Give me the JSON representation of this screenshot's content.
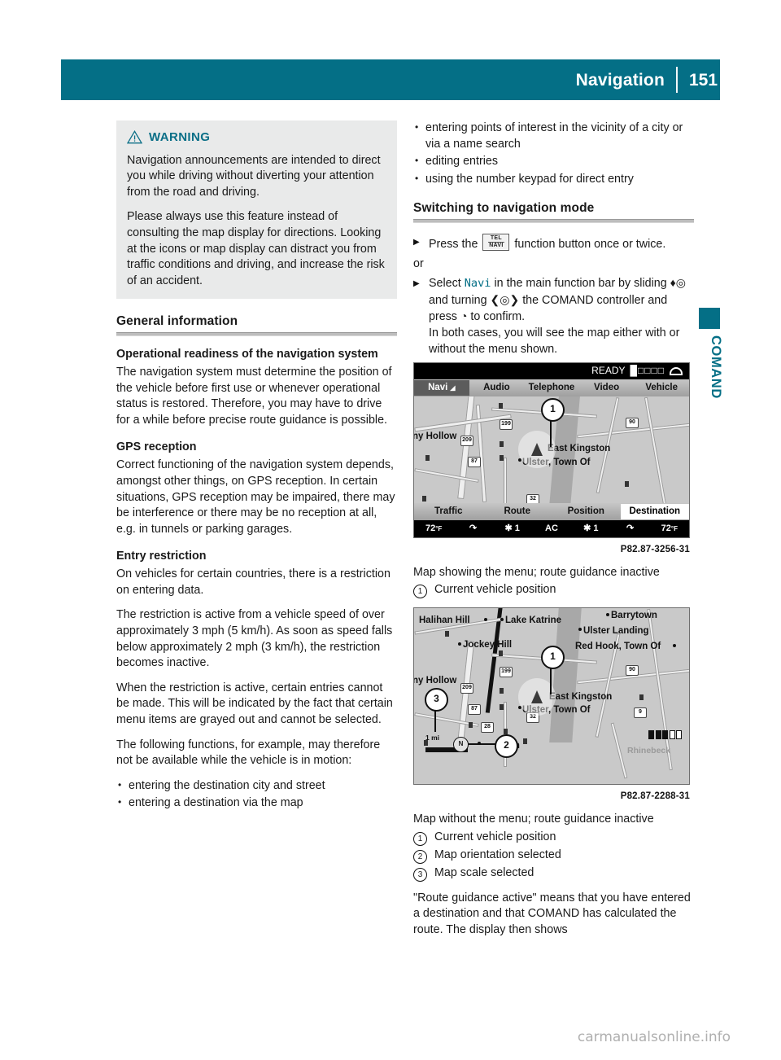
{
  "header": {
    "title": "Navigation",
    "page_number": "151",
    "accent_color": "#046f86"
  },
  "side_tab": {
    "label": "COMAND"
  },
  "footer": {
    "watermark": "carmanualsonline.info"
  },
  "warning": {
    "icon": "warning-triangle-icon",
    "label": "WARNING",
    "paragraphs": [
      "Navigation announcements are intended to direct you while driving without diverting your attention from the road and driving.",
      "Please always use this feature instead of consulting the map display for directions. Looking at the icons or map display can distract you from traffic conditions and driving, and increase the risk of an accident."
    ]
  },
  "left_column": {
    "section_title": "General information",
    "sub1_title": "Operational readiness of the navigation system",
    "sub1_text": "The navigation system must determine the position of the vehicle before first use or whenever operational status is restored. Therefore, you may have to drive for a while before precise route guidance is possible.",
    "sub2_title": "GPS reception",
    "sub2_text": "Correct functioning of the navigation system depends, amongst other things, on GPS reception. In certain situations, GPS reception may be impaired, there may be interference or there may be no reception at all, e.g. in tunnels or parking garages.",
    "sub3_title": "Entry restriction",
    "sub3_p1": "On vehicles for certain countries, there is a restriction on entering data.",
    "sub3_p2": "The restriction is active from a vehicle speed of over approximately 3 mph (5 km/h). As soon as speed falls below approximately 2 mph (3 km/h), the restriction becomes inactive.",
    "sub3_p3": "When the restriction is active, certain entries cannot be made. This will be indicated by the fact that certain menu items are grayed out and cannot be selected.",
    "sub3_p4": "The following functions, for example, may therefore not be available while the vehicle is in motion:",
    "bullets": [
      "entering the destination city and street",
      "entering a destination via the map"
    ]
  },
  "right_column": {
    "bullets_continued": [
      "entering points of interest in the vicinity of a city or via a name search",
      "editing entries",
      "using the number keypad for direct entry"
    ],
    "section_title": "Switching to navigation mode",
    "step1_before": "Press the",
    "step1_key_top": "TEL",
    "step1_key_bottom": "NAVI",
    "step1_after": "function button once or twice.",
    "or_text": "or",
    "step2_a": "Select",
    "step2_highlight": "Navi",
    "step2_b": "in the main function bar by sliding",
    "step2_slide_symbol": "♦◎",
    "step2_c": "and turning",
    "step2_turn_symbol": "❮◎❯",
    "step2_d": "the COMAND controller and press",
    "step2_press_symbol": "◔",
    "step2_e": "to confirm.",
    "step2_note": "In both cases, you will see the map either with or without the menu shown.",
    "closing_paragraph": "\"Route guidance active\" means that you have entered a destination and that COMAND has calculated the route. The display then shows"
  },
  "figure1": {
    "reference": "P82.87-3256-31",
    "caption": "Map showing the menu; route guidance inactive",
    "status_text": "READY",
    "status_blocks": "█□□□□",
    "phone_icon": "phone-handset-icon",
    "menu_items": [
      "Navi",
      "Audio",
      "Telephone",
      "Video",
      "Vehicle"
    ],
    "menu_selected": "Navi",
    "bottom_items": [
      "Traffic",
      "Route",
      "Position",
      "Destination"
    ],
    "bottom_selected": "Destination",
    "climate": {
      "left_temp": "72",
      "left_unit": "F",
      "right_temp": "72",
      "right_unit": "F",
      "left_fan": "1",
      "right_fan": "1",
      "ac_label": "AC"
    },
    "map_labels": [
      "ny Hollow",
      "East Kingston",
      "Ulster, Town Of"
    ],
    "route_shields": [
      "199",
      "209",
      "87",
      "90",
      "32"
    ],
    "legend": [
      {
        "number": "1",
        "text": "Current vehicle position"
      }
    ]
  },
  "figure2": {
    "reference": "P82.87-2288-31",
    "caption": "Map without the menu; route guidance inactive",
    "map_labels": [
      "Halihan Hill",
      "Lake Katrine",
      "Barrytown",
      "Ulster Landing",
      "Jockey Hill",
      "Red Hook, Town Of",
      "ny Hollow",
      "East Kingston",
      "Ulster, Town Of",
      "ton",
      "Rhinebeck"
    ],
    "route_shields": [
      "199",
      "209",
      "87",
      "90",
      "32",
      "28",
      "9"
    ],
    "map_scale": "1 mi",
    "legend": [
      {
        "number": "1",
        "text": "Current vehicle position"
      },
      {
        "number": "2",
        "text": "Map orientation selected"
      },
      {
        "number": "3",
        "text": "Map scale selected"
      }
    ]
  }
}
